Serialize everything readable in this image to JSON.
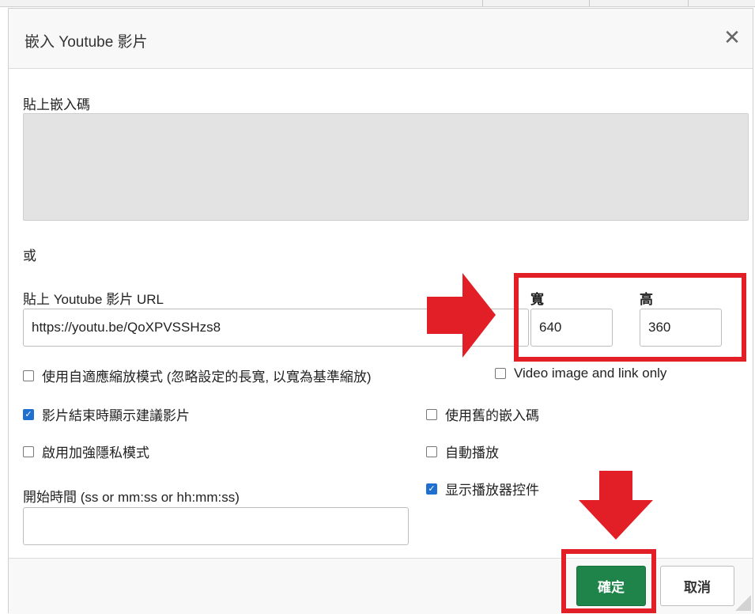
{
  "dialog": {
    "title": "嵌入 Youtube 影片",
    "close_label": "✕"
  },
  "embed_code": {
    "label": "貼上嵌入碼",
    "value": ""
  },
  "or_label": "或",
  "url": {
    "label": "貼上 Youtube 影片 URL",
    "value": "https://youtu.be/QoXPVSSHzs8"
  },
  "size": {
    "width_label": "寬",
    "width_value": "640",
    "height_label": "高",
    "height_value": "360"
  },
  "options": {
    "responsive": {
      "label": "使用自適應縮放模式 (忽略設定的長寬, 以寬為基準縮放)",
      "checked": false
    },
    "image_link_only": {
      "label": "Video image and link only",
      "checked": false
    },
    "show_related": {
      "label": "影片結束時顯示建議影片",
      "checked": true
    },
    "old_embed": {
      "label": "使用舊的嵌入碼",
      "checked": false
    },
    "privacy_mode": {
      "label": "啟用加強隱私模式",
      "checked": false
    },
    "autoplay": {
      "label": "自動播放",
      "checked": false
    },
    "show_controls": {
      "label": "显示播放器控件",
      "checked": true
    }
  },
  "start_time": {
    "label": "開始時間 (ss or mm:ss or hh:mm:ss)",
    "value": ""
  },
  "footer": {
    "ok_label": "確定",
    "cancel_label": "取消"
  },
  "annotations": {
    "highlight_color": "#e21e26"
  }
}
